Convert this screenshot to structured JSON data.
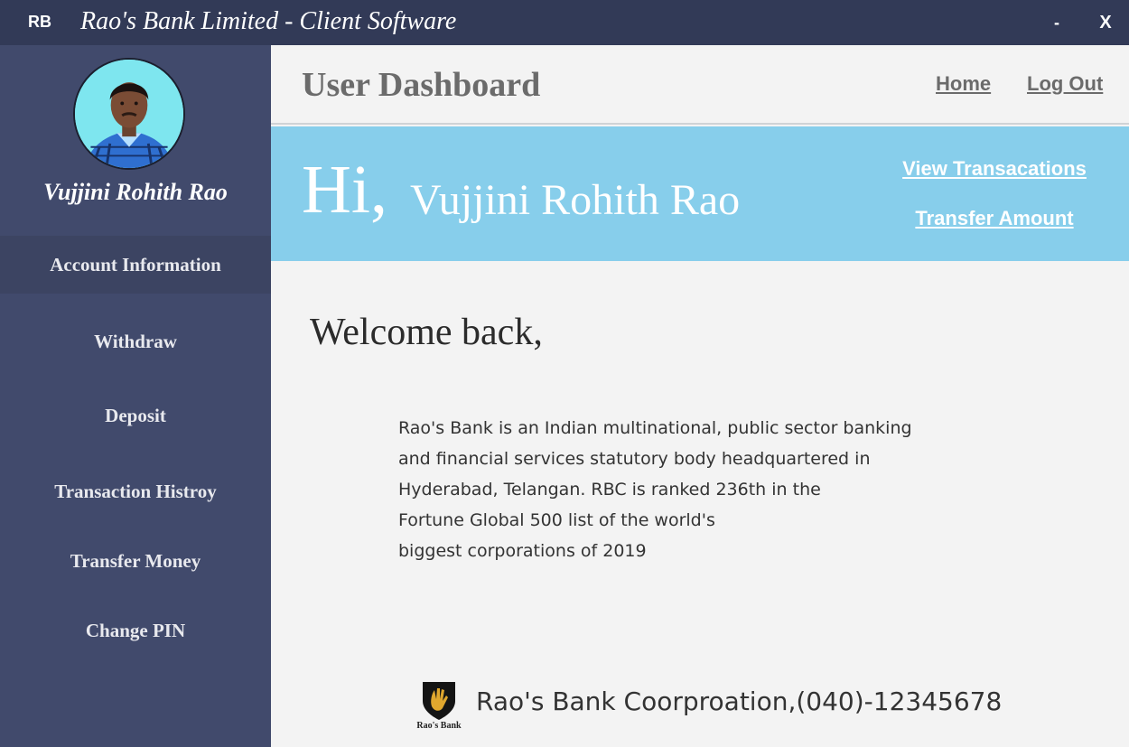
{
  "window": {
    "logo": "RB",
    "title": "Rao's Bank Limited - Client Software",
    "minimize_label": "-",
    "close_label": "X"
  },
  "sidebar": {
    "user_name": "Vujjini Rohith Rao",
    "items": [
      {
        "label": "Account Information"
      },
      {
        "label": "Withdraw"
      },
      {
        "label": "Deposit"
      },
      {
        "label": "Transaction Histroy"
      },
      {
        "label": "Transfer Money"
      },
      {
        "label": "Change PIN"
      }
    ]
  },
  "header": {
    "title": "User Dashboard",
    "home_link": "Home",
    "logout_link": "Log Out"
  },
  "banner": {
    "greeting": "Hi,",
    "name": "Vujjini Rohith Rao",
    "view_transactions_link": "View Transacations",
    "transfer_amount_link": "Transfer Amount"
  },
  "main": {
    "welcome": "Welcome back,",
    "about_lines": [
      "Rao's Bank is an Indian multinational, public sector banking",
      "and financial services statutory body headquartered in",
      "Hyderabad, Telangan. RBC is ranked 236th in the",
      "Fortune Global 500 list of the world's",
      "biggest corporations of 2019"
    ]
  },
  "footer": {
    "logo_text": "Rao's Bank",
    "text": "Rao's Bank Coorproation,(040)-12345678"
  },
  "colors": {
    "titlebar": "#323a57",
    "sidebar": "#414a6c",
    "banner": "#87ceeb",
    "content_bg": "#f3f3f3"
  }
}
